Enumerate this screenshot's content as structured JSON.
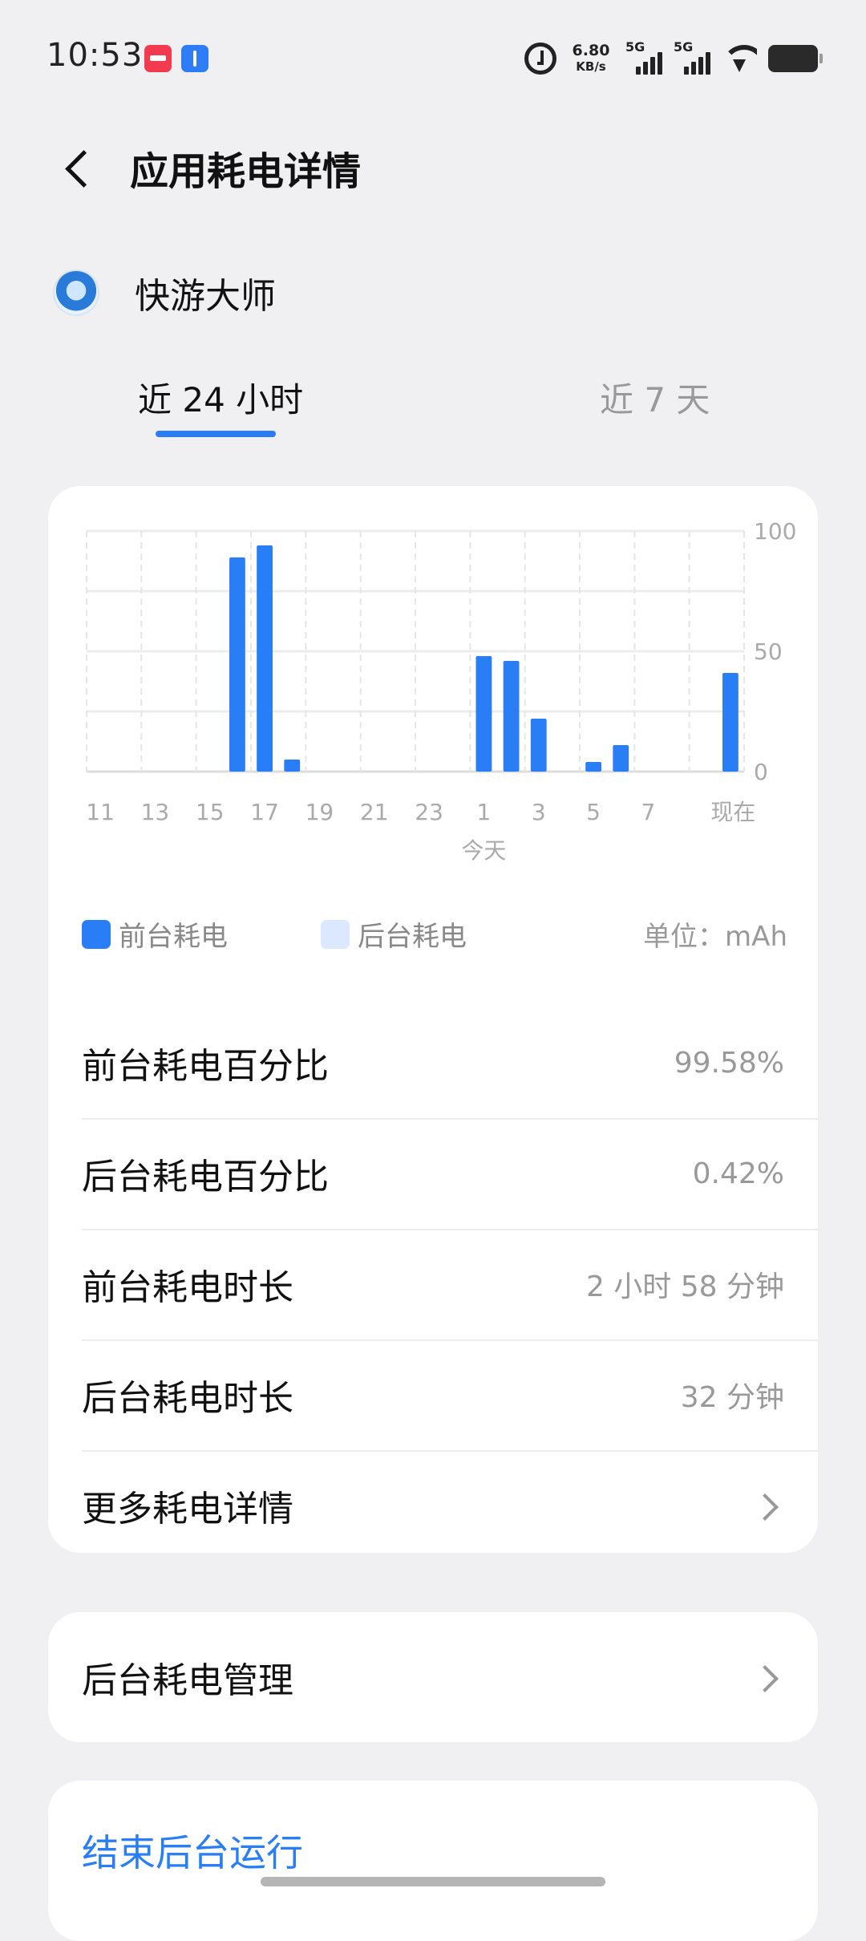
{
  "status_bar": {
    "time": "10:53",
    "net_speed_value": "6.80",
    "net_speed_unit": "KB/s",
    "signal1_label": "5G",
    "signal2_label": "5G",
    "notif_icons": [
      "red-app-icon",
      "usb-icon"
    ]
  },
  "header": {
    "title": "应用耗电详情"
  },
  "app": {
    "name": "快游大师"
  },
  "tabs": [
    {
      "label": "近 24 小时",
      "active": true
    },
    {
      "label": "近 7 天",
      "active": false
    }
  ],
  "colors": {
    "accent": "#2a7ef5",
    "foreground_bar": "#2a7ef5",
    "background_bar": "#dce8ff",
    "page_bg": "#f0f0f3"
  },
  "chart_data": {
    "type": "bar",
    "categories": [
      "11",
      "12",
      "13",
      "14",
      "15",
      "16",
      "17",
      "18",
      "19",
      "20",
      "21",
      "22",
      "23",
      "0",
      "1",
      "2",
      "3",
      "4",
      "5",
      "6",
      "7",
      "8",
      "9",
      "现在"
    ],
    "x_tick_labels": [
      "11",
      "13",
      "15",
      "17",
      "19",
      "21",
      "23",
      "1",
      "3",
      "5",
      "7",
      "现在"
    ],
    "x_sublabel": "今天",
    "series": [
      {
        "name": "前台耗电",
        "values": [
          0,
          0,
          0,
          0,
          0,
          89,
          94,
          5,
          0,
          0,
          0,
          0,
          0,
          0,
          48,
          46,
          22,
          0,
          4,
          11,
          0,
          0,
          0,
          41
        ]
      },
      {
        "name": "后台耗电",
        "values": [
          0,
          0,
          0,
          0,
          0,
          0,
          0,
          0,
          0,
          0,
          0,
          0,
          0,
          0,
          0,
          0,
          0,
          0,
          0,
          0,
          0,
          0,
          0,
          0
        ]
      }
    ],
    "ylim": [
      0,
      100
    ],
    "y_tick_labels": [
      "100",
      "50",
      "0"
    ],
    "y_axis_side": "right",
    "grid": true
  },
  "legend": {
    "foreground": "前台耗电",
    "background": "后台耗电",
    "unit": "单位：mAh"
  },
  "stats": [
    {
      "label": "前台耗电百分比",
      "value": "99.58%"
    },
    {
      "label": "后台耗电百分比",
      "value": "0.42%"
    },
    {
      "label": "前台耗电时长",
      "value": "2 小时 58 分钟"
    },
    {
      "label": "后台耗电时长",
      "value": "32 分钟"
    }
  ],
  "more_details": "更多耗电详情",
  "bg_management": "后台耗电管理",
  "stop_background": "结束后台运行"
}
